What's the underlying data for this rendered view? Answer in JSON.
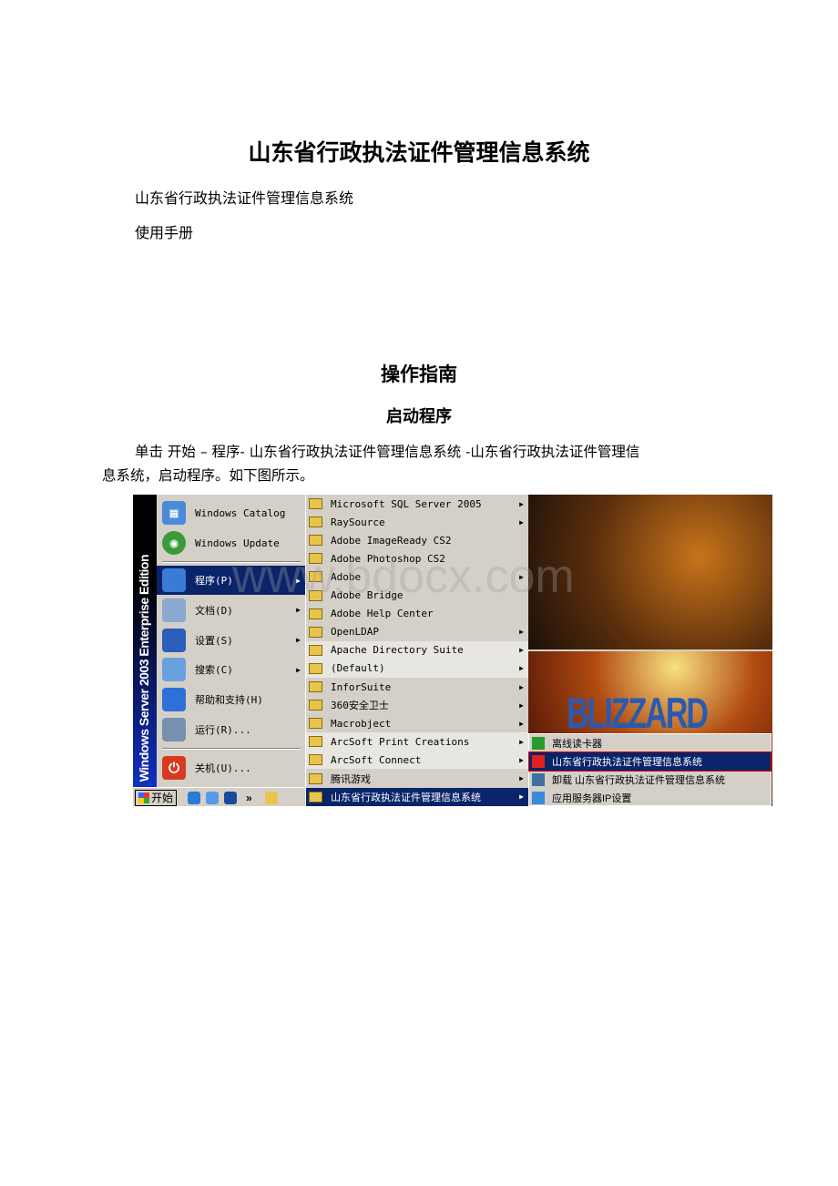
{
  "title": "山东省行政执法证件管理信息系统",
  "subtitle": "山东省行政执法证件管理信息系统",
  "manual": "使用手册",
  "section": "操作指南",
  "subsection": "启动程序",
  "para_line1": "单击 开始 – 程序- 山东省行政执法证件管理信息系统 -山东省行政执法证件管理信",
  "para_line2": "息系统，启动程序。如下图所示。",
  "watermark": "www.bdocx.com",
  "screenshot": {
    "side_banner": "Windows Server 2003  Enterprise Edition",
    "pinned": [
      {
        "label": "Windows Catalog",
        "icon": "windows-catalog-icon"
      },
      {
        "label": "Windows Update",
        "icon": "windows-update-icon"
      }
    ],
    "start_items": [
      {
        "label": "程序(P)",
        "icon": "programs-icon",
        "arrow": true,
        "color": "#3a7bd5"
      },
      {
        "label": "文档(D)",
        "icon": "documents-icon",
        "arrow": true,
        "color": "#8aa8d0"
      },
      {
        "label": "设置(S)",
        "icon": "settings-icon",
        "arrow": true,
        "color": "#2b5fb8"
      },
      {
        "label": "搜索(C)",
        "icon": "search-icon",
        "arrow": true,
        "color": "#6aa0e0"
      },
      {
        "label": "帮助和支持(H)",
        "icon": "help-icon",
        "arrow": false,
        "color": "#2f6fd8"
      },
      {
        "label": "运行(R)...",
        "icon": "run-icon",
        "arrow": false,
        "color": "#7890b0"
      }
    ],
    "shutdown": {
      "label": "关机(U)...",
      "icon": "shutdown-icon",
      "color": "#d83a20"
    },
    "programs": [
      {
        "label": "Microsoft SQL Server 2005",
        "arrow": true
      },
      {
        "label": "RaySource",
        "arrow": true
      },
      {
        "label": "Adobe ImageReady CS2",
        "arrow": false
      },
      {
        "label": "Adobe Photoshop CS2",
        "arrow": false
      },
      {
        "label": "Adobe",
        "arrow": true
      },
      {
        "label": "Adobe Bridge",
        "arrow": false
      },
      {
        "label": "Adobe Help Center",
        "arrow": false
      },
      {
        "label": "OpenLDAP",
        "arrow": true
      },
      {
        "label": "Apache Directory Suite",
        "arrow": true
      },
      {
        "label": "(Default)",
        "arrow": true
      },
      {
        "label": "InforSuite",
        "arrow": true
      },
      {
        "label": "360安全卫士",
        "arrow": true
      },
      {
        "label": "Macrobject",
        "arrow": true
      },
      {
        "label": "ArcSoft Print Creations",
        "arrow": true
      },
      {
        "label": "ArcSoft Connect",
        "arrow": true
      },
      {
        "label": "腾讯游戏",
        "arrow": true
      },
      {
        "label": "山东省行政执法证件管理信息系统",
        "arrow": true
      }
    ],
    "submenu": [
      {
        "label": "离线读卡器",
        "icon": "puzzle-icon",
        "color": "#2a9a2a"
      },
      {
        "label": "山东省行政执法证件管理信息系统",
        "icon": "app-icon",
        "color": "#e02020"
      },
      {
        "label": "卸载 山东省行政执法证件管理信息系统",
        "icon": "uninstall-icon",
        "color": "#4070a0"
      },
      {
        "label": "应用服务器IP设置",
        "icon": "network-icon",
        "color": "#3a8ad8"
      }
    ],
    "background_logo": "BLIZZARD",
    "taskbar": {
      "start": "开始",
      "more": "»"
    }
  }
}
